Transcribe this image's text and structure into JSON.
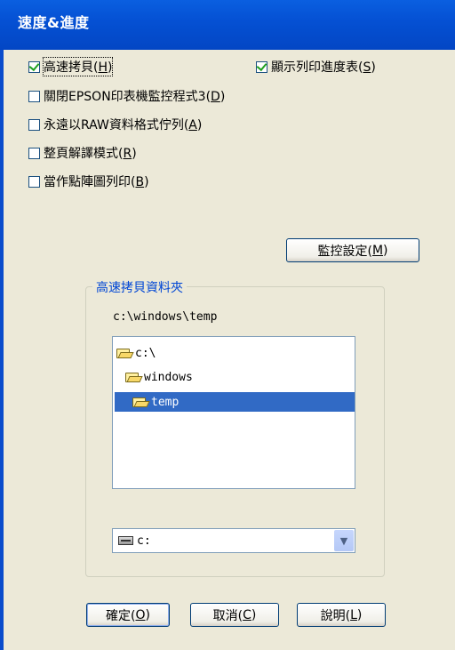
{
  "window": {
    "title": "速度&進度"
  },
  "options": [
    {
      "pre": "高速拷貝(",
      "key": "H",
      "post": ")",
      "checked": true
    },
    {
      "pre": "顯示列印進度表(",
      "key": "S",
      "post": ")",
      "checked": true
    },
    {
      "pre": "關閉EPSON印表機監控程式3(",
      "key": "D",
      "post": ")",
      "checked": false
    },
    {
      "pre": "永遠以RAW資料格式佇列(",
      "key": "A",
      "post": ")",
      "checked": false
    },
    {
      "pre": "整頁解譯模式(",
      "key": "R",
      "post": ")",
      "checked": false
    },
    {
      "pre": "當作點陣圖列印(",
      "key": "B",
      "post": ")",
      "checked": false
    }
  ],
  "monitor_button": {
    "pre": "監控設定(",
    "key": "M",
    "post": ")"
  },
  "folder_group": {
    "title": "高速拷貝資料夾",
    "current_path": "c:\\windows\\temp",
    "tree": [
      {
        "label": "c:\\",
        "icon": "open-folder-icon"
      },
      {
        "label": "windows",
        "icon": "open-folder-icon"
      },
      {
        "label": "temp",
        "icon": "open-folder-icon",
        "selected": true
      }
    ],
    "drive": {
      "value": "c:",
      "icon": "drive-icon"
    }
  },
  "buttons": {
    "ok": {
      "pre": "確定(",
      "key": "O",
      "post": ")"
    },
    "cancel": {
      "pre": "取消(",
      "key": "C",
      "post": ")"
    },
    "help": {
      "pre": "說明(",
      "key": "L",
      "post": ")"
    }
  },
  "colors": {
    "title_bar": "#0551d4",
    "dialog_bg": "#ece9d8",
    "selection": "#316ac5",
    "group_title": "#0046d5"
  }
}
